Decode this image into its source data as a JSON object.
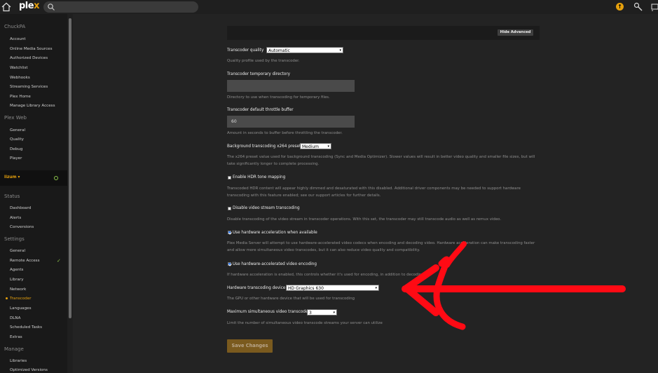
{
  "topbar": {
    "logo": "plex",
    "logo_accent": "x",
    "logo_main": "ple",
    "upd": "↑"
  },
  "sidebar": {
    "account_header": "ChuckPA",
    "account_items": [
      "Account",
      "Online Media Sources",
      "Authorized Devices",
      "Watchlist",
      "Webhooks",
      "Streaming Services",
      "Plex Home",
      "Manage Library Access"
    ],
    "plexweb_header": "Plex Web",
    "plexweb_items": [
      "General",
      "Quality",
      "Debug",
      "Player"
    ],
    "server_name": "lizum ▾",
    "status_header": "Status",
    "status_items": [
      "Dashboard",
      "Alerts",
      "Conversions"
    ],
    "settings_header": "Settings",
    "settings_items": [
      "General",
      "Remote Access",
      "Agents",
      "Library",
      "Network",
      "Transcoder",
      "Languages",
      "DLNA",
      "Scheduled Tasks",
      "Extras"
    ],
    "manage_header": "Manage",
    "manage_items": [
      "Libraries",
      "Optimized Versions"
    ],
    "check": "✓"
  },
  "main": {
    "hide_advanced": "Hide Advanced",
    "transcoder_quality": {
      "label": "Transcoder quality",
      "value": "Automatic",
      "help": "Quality profile used by the transcoder."
    },
    "temp_dir": {
      "label": "Transcoder temporary directory",
      "value": "",
      "help": "Directory to use when transcoding for temporary files."
    },
    "throttle": {
      "label": "Transcoder default throttle buffer",
      "value": "60",
      "help": "Amount in seconds to buffer before throttling the transcoder."
    },
    "x264": {
      "label": "Background transcoding x264 preset",
      "value": "Medium",
      "help": "The x264 preset value used for background transcoding (Sync and Media Optimizer). Slower values will result in better video quality and smaller file sizes, but will take significantly longer to complete processing."
    },
    "hdr": {
      "label": "Enable HDR tone mapping",
      "checked": false,
      "help": "Transcoded HDR content will appear highly dimmed and desaturated with this disabled. Additional driver components may be needed to support hardware transcoding with this feature enabled; see our support articles for further details."
    },
    "disable_video": {
      "label": "Disable video stream transcoding",
      "checked": false,
      "help": "Disable transcoding of the video stream in transcoder operations. With this set, the transcoder may still transcode audio as well as remux video."
    },
    "hw_accel": {
      "label": "Use hardware acceleration when available",
      "checked": true,
      "help": "Plex Media Server will attempt to use hardware-accelerated video codecs when encoding and decoding video. Hardware acceleration can make transcoding faster and allow more simultaneous video transcodes, but it can also reduce video quality and compatibility."
    },
    "hw_encode": {
      "label": "Use hardware-accelerated video encoding",
      "checked": true,
      "help": "If hardware acceleration is enabled, this controls whether it's used for encoding, in addition to decoding."
    },
    "hw_device": {
      "label": "Hardware transcoding device",
      "value": "HD Graphics 630",
      "help": "The GPU or other hardware device that will be used for transcoding"
    },
    "max_transcode": {
      "label": "Maximum simultaneous video transcode",
      "value": "3",
      "help": "Limit the number of simultaneous video transcode streams your server can utilize"
    },
    "save": "Save Changes",
    "caret": "▾"
  },
  "colors": {
    "accent": "#e5a00d",
    "annotation": "#ff0a14",
    "ok": "#8bc34a"
  }
}
